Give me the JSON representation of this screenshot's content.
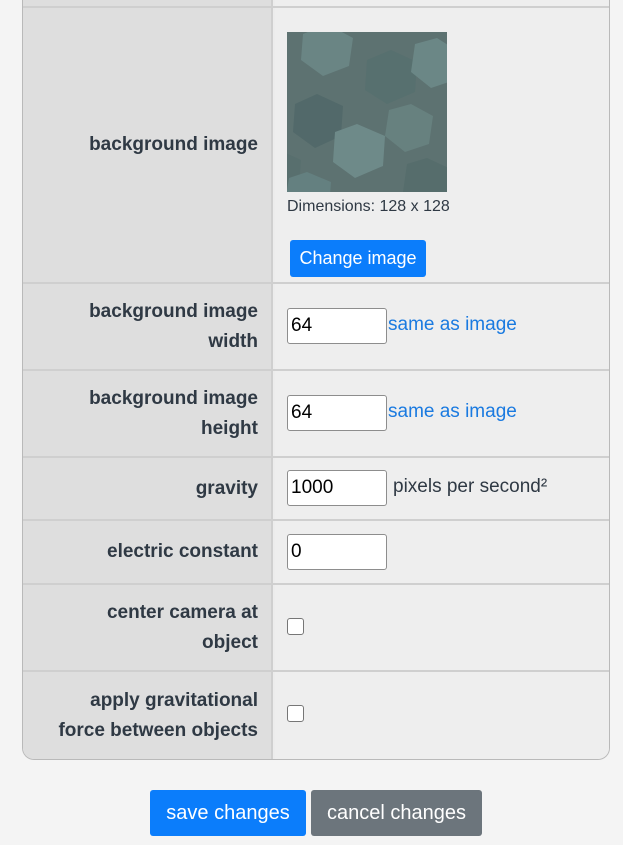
{
  "background_image": {
    "label": "background image",
    "dimensions_text": "Dimensions: 128 x 128",
    "change_button": "Change image"
  },
  "bg_width": {
    "label": "background image width",
    "value": "64",
    "link": "same as image"
  },
  "bg_height": {
    "label": "background image height",
    "value": "64",
    "link": "same as image"
  },
  "gravity": {
    "label": "gravity",
    "value": "1000",
    "unit": "pixels per second²"
  },
  "electric_constant": {
    "label": "electric constant",
    "value": "0"
  },
  "center_camera": {
    "label": "center camera at object",
    "checked": false
  },
  "apply_gravitational_force": {
    "label": "apply gravitational force between objects",
    "checked": false
  },
  "actions": {
    "save": "save changes",
    "cancel": "cancel changes"
  },
  "colors": {
    "accent": "#0b7dfb",
    "link": "#1a7ae0",
    "secondary": "#6c757c",
    "label_text": "#2f3944"
  }
}
